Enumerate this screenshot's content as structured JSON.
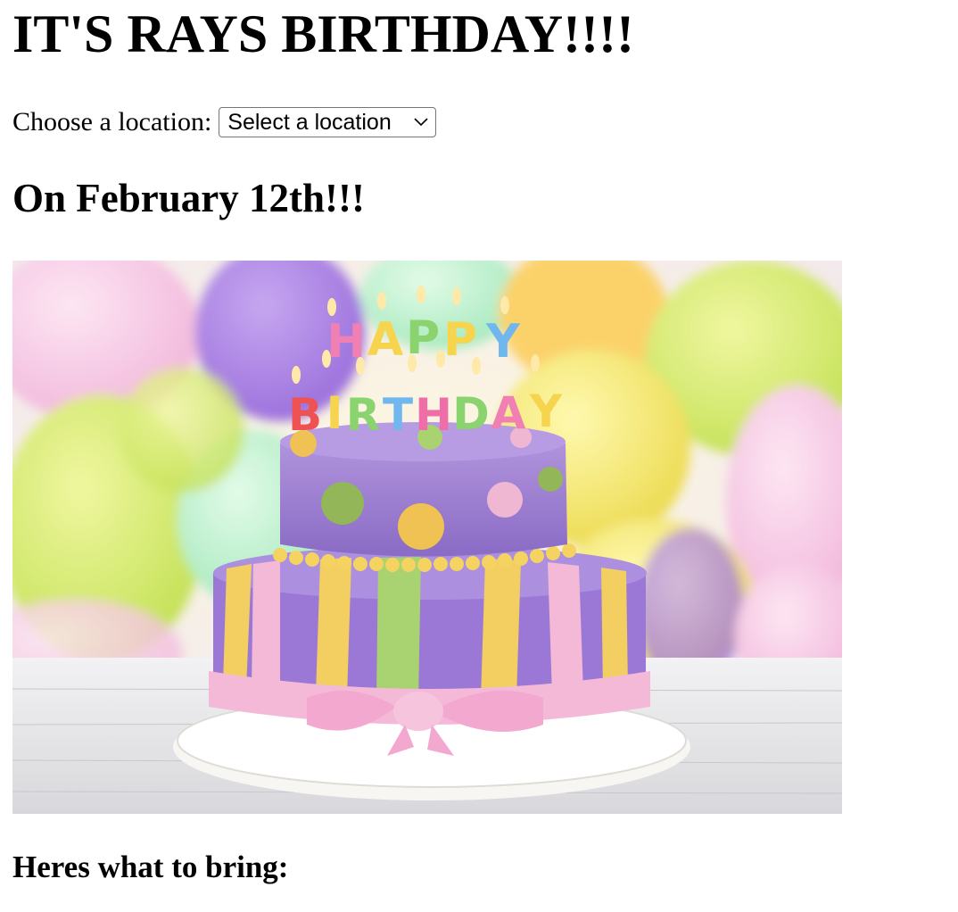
{
  "page": {
    "title": "IT'S RAYS BIRTHDAY!!!!",
    "date_heading": "On February 12th!!!",
    "bring_heading": "Heres what to bring:"
  },
  "location": {
    "label": "Choose a location:",
    "selected": "Select a location"
  },
  "image": {
    "subject": "birthday-cake-photo",
    "cake_topper_lines": [
      "HAPPY",
      "BIRTHDAY"
    ]
  }
}
